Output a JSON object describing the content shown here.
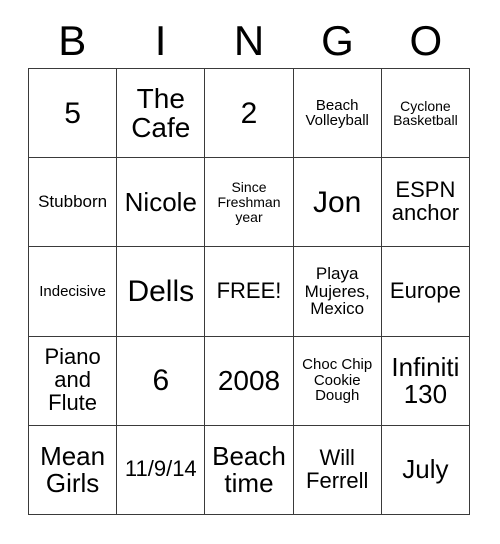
{
  "card": {
    "title_letters": [
      "B",
      "I",
      "N",
      "G",
      "O"
    ],
    "free_space_label": "FREE!",
    "colors": {
      "background": "#ffffff",
      "text": "#000000",
      "grid_line": "#3a3a3a"
    },
    "rows": [
      [
        {
          "text": "5",
          "size": "fs-xxl"
        },
        {
          "text": "The Cafe",
          "size": "fs-xl"
        },
        {
          "text": "2",
          "size": "fs-xxl"
        },
        {
          "text": "Beach Volleyball",
          "size": "fs-xs"
        },
        {
          "text": "Cyclone Basketball",
          "size": "fs-xxs"
        }
      ],
      [
        {
          "text": "Stubborn",
          "size": "fs-sm"
        },
        {
          "text": "Nicole",
          "size": "fs-lg"
        },
        {
          "text": "Since Freshman year",
          "size": "fs-xxs"
        },
        {
          "text": "Jon",
          "size": "fs-xxl"
        },
        {
          "text": "ESPN anchor",
          "size": "fs-md"
        }
      ],
      [
        {
          "text": "Indecisive",
          "size": "fs-xs"
        },
        {
          "text": "Dells",
          "size": "fs-xxl"
        },
        {
          "text": "FREE!",
          "size": "fs-md"
        },
        {
          "text": "Playa Mujeres, Mexico",
          "size": "fs-sm"
        },
        {
          "text": "Europe",
          "size": "fs-md"
        }
      ],
      [
        {
          "text": "Piano and Flute",
          "size": "fs-md"
        },
        {
          "text": "6",
          "size": "fs-xxl"
        },
        {
          "text": "2008",
          "size": "fs-xl"
        },
        {
          "text": "Choc Chip Cookie Dough",
          "size": "fs-xs"
        },
        {
          "text": "Infiniti 130",
          "size": "fs-lg"
        }
      ],
      [
        {
          "text": "Mean Girls",
          "size": "fs-lg"
        },
        {
          "text": "11/9/14",
          "size": "fs-md"
        },
        {
          "text": "Beach time",
          "size": "fs-lg"
        },
        {
          "text": "Will Ferrell",
          "size": "fs-md"
        },
        {
          "text": "July",
          "size": "fs-lg"
        }
      ]
    ]
  }
}
